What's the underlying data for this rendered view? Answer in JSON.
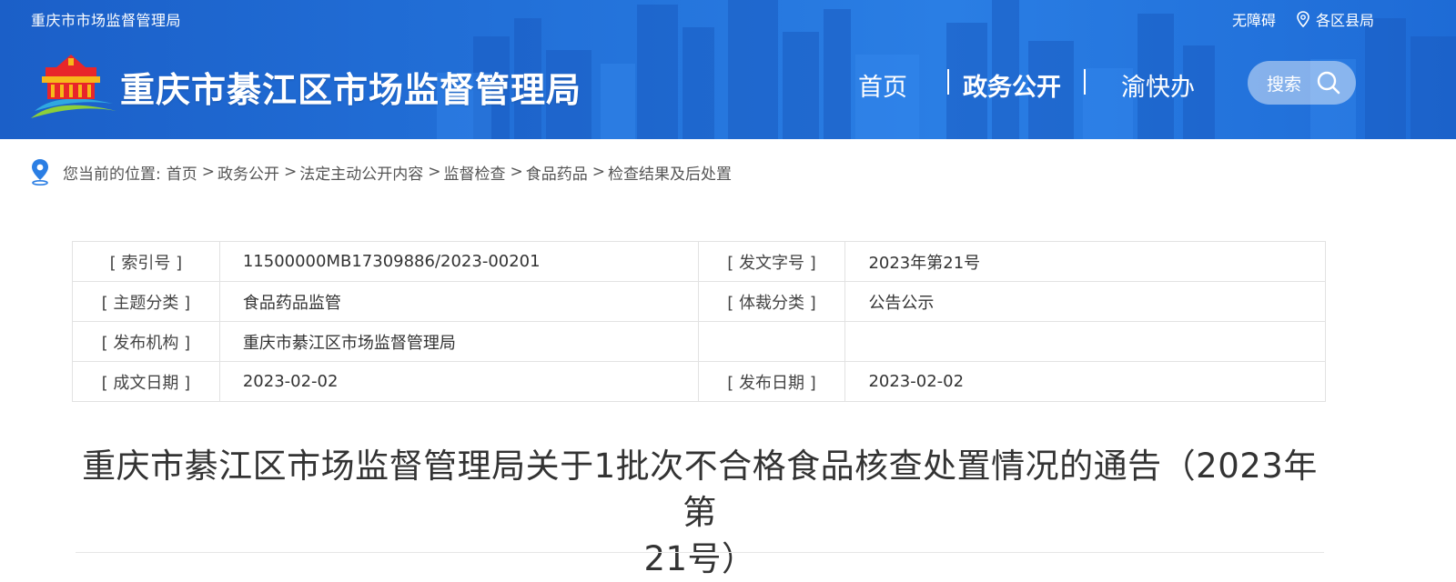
{
  "header": {
    "top_title": "重庆市市场监督管理局",
    "accessibility_label": "无障碍",
    "districts_label": "各区县局",
    "site_name": "重庆市綦江区市场监督管理局",
    "nav": [
      {
        "label": "首页",
        "active": false
      },
      {
        "label": "政务公开",
        "active": true
      },
      {
        "label": "渝快办",
        "active": false
      }
    ],
    "search_label": "搜索",
    "colors": {
      "primary": "#1f6ad6",
      "text": "#ffffff"
    }
  },
  "breadcrumb": {
    "prefix": "您当前的位置:",
    "items": [
      "首页",
      "政务公开",
      "法定主动公开内容",
      "监督检查",
      "食品药品",
      "检查结果及后处置"
    ],
    "separator": ">"
  },
  "info_table": {
    "rows": [
      {
        "label1": "[ 索引号 ]",
        "value1": "11500000MB17309886/2023-00201",
        "label2": "[ 发文字号 ]",
        "value2": "2023年第21号"
      },
      {
        "label1": "[ 主题分类 ]",
        "value1": "食品药品监管",
        "label2": "[ 体裁分类 ]",
        "value2": "公告公示"
      },
      {
        "label1": "[ 发布机构 ]",
        "value1": "重庆市綦江区市场监督管理局",
        "label2": "",
        "value2": ""
      },
      {
        "label1": "[ 成文日期 ]",
        "value1": "2023-02-02",
        "label2": "[ 发布日期 ]",
        "value2": "2023-02-02"
      }
    ]
  },
  "article": {
    "title_line1": "重庆市綦江区市场监督管理局关于1批次不合格食品核查处置情况的通告（2023年第",
    "title_line2": "21号）"
  }
}
